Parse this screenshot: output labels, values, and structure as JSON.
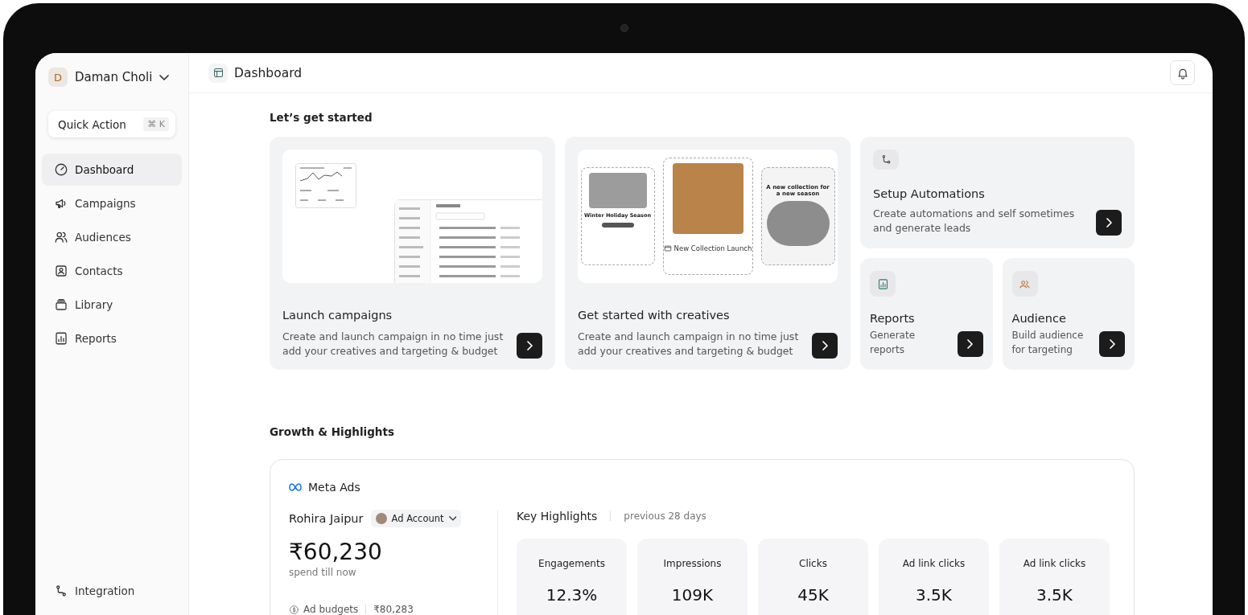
{
  "sidebar": {
    "user": {
      "initial": "D",
      "name": "Daman Choli"
    },
    "quick_action": {
      "label": "Quick Action",
      "shortcut": "⌘ K"
    },
    "items": [
      {
        "label": "Dashboard",
        "kind": "gauge",
        "selected": true
      },
      {
        "label": "Campaigns",
        "kind": "megaphone",
        "selected": false
      },
      {
        "label": "Audiences",
        "kind": "users",
        "selected": false
      },
      {
        "label": "Contacts",
        "kind": "contact",
        "selected": false
      },
      {
        "label": "Library",
        "kind": "library",
        "selected": false
      },
      {
        "label": "Reports",
        "kind": "reports",
        "selected": false
      }
    ],
    "footer_item": {
      "label": "Integration"
    }
  },
  "header": {
    "title": "Dashboard"
  },
  "get_started": {
    "title": "Let’s get started",
    "large_cards": [
      {
        "kind": "app",
        "title": "Launch campaigns",
        "description": "Create and launch campaign in no time just add your creatives and targeting & budget"
      },
      {
        "kind": "creatives",
        "title": "Get started with creatives",
        "description": "Create and launch campaign in no time just add your creatives and targeting & budget",
        "previews": [
          "Winter Holiday Season",
          "New Collection Launch",
          "A new collection for a new season"
        ]
      }
    ],
    "small_cards": [
      {
        "kind": "automation",
        "title": "Setup Automations",
        "description": "Create automations and self sometimes and generate leads"
      },
      {
        "kind": "reports",
        "title": "Reports",
        "description": "Generate reports"
      },
      {
        "kind": "audience",
        "title": "Audience",
        "description": "Build audience for targeting"
      }
    ]
  },
  "growth": {
    "title": "Growth & Highlights",
    "source": "Meta Ads",
    "account_name": "Rohira Jaipur",
    "account_picker": "Ad Account",
    "spend": "₹60,230",
    "spend_caption": "spend till now",
    "budget_label": "Ad budgets",
    "budget_value": "₹80,283",
    "highlights_title": "Key Highlights",
    "highlights_period": "previous 28 days",
    "stats": [
      {
        "label": "Engagements",
        "value": "12.3%"
      },
      {
        "label": "Impressions",
        "value": "109K"
      },
      {
        "label": "Clicks",
        "value": "45K"
      },
      {
        "label": "Ad link clicks",
        "value": "3.5K"
      },
      {
        "label": "Ad link clicks",
        "value": "3.5K"
      }
    ]
  }
}
